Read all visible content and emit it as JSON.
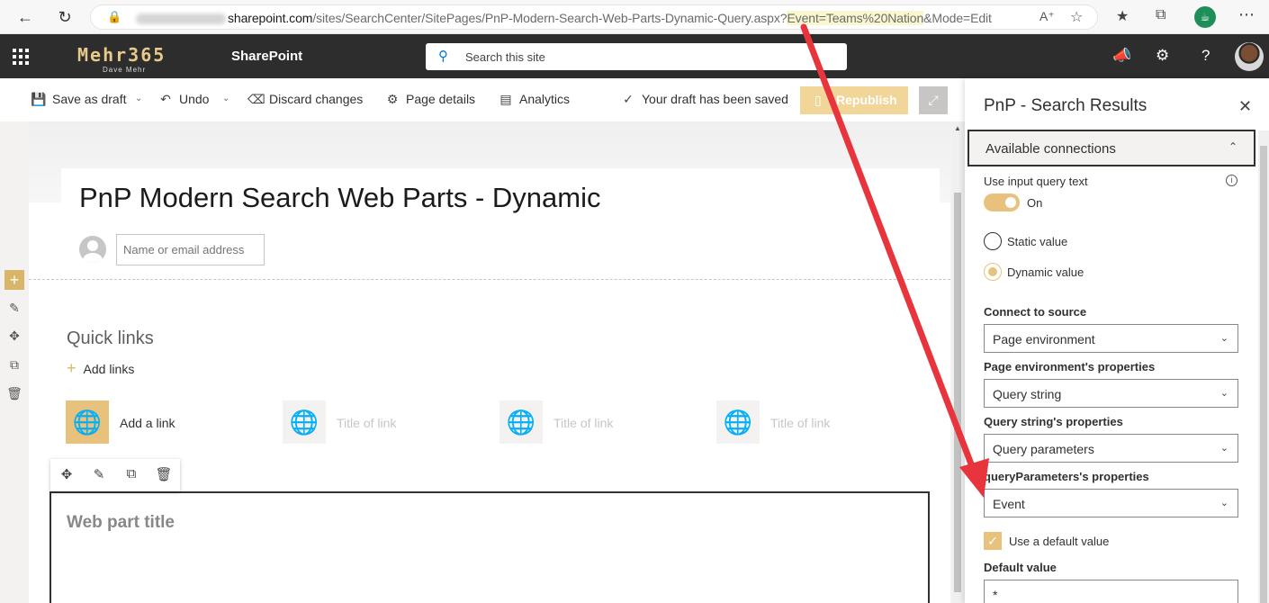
{
  "browser": {
    "url_domain": "sharepoint.com",
    "url_path": "/sites/SearchCenter/SitePages/PnP-Modern-Search-Web-Parts-Dynamic-Query.aspx?",
    "url_query_highlight": "Event=Teams%20Nation",
    "url_query_rest": "&Mode=Edit"
  },
  "suite": {
    "logo_text": "Mehr365",
    "logo_sub": "Dave Mehr",
    "app_name": "SharePoint",
    "search_placeholder": "Search this site"
  },
  "command_bar": {
    "save_draft": "Save as draft",
    "undo": "Undo",
    "discard": "Discard changes",
    "page_details": "Page details",
    "analytics": "Analytics",
    "status": "Your draft has been saved",
    "republish": "Republish"
  },
  "page": {
    "title": "PnP Modern Search Web Parts - Dynamic",
    "author_placeholder": "Name or email address",
    "quick_links": {
      "title": "Quick links",
      "add_links": "Add links",
      "tiles": [
        {
          "label": "Add a link"
        },
        {
          "label": "Title of link"
        },
        {
          "label": "Title of link"
        },
        {
          "label": "Title of link"
        }
      ]
    },
    "web_part_title": "Web part title"
  },
  "property_pane": {
    "title": "PnP - Search Results",
    "group": "Available connections",
    "use_input_query_text": "Use input query text",
    "toggle_state": "On",
    "static_value": "Static value",
    "dynamic_value": "Dynamic value",
    "connect_to_source_label": "Connect to source",
    "connect_to_source_value": "Page environment",
    "page_env_props_label": "Page environment's properties",
    "page_env_props_value": "Query string",
    "query_string_props_label": "Query string's properties",
    "query_string_props_value": "Query parameters",
    "query_params_props_label": "queryParameters's properties",
    "query_params_props_value": "Event",
    "use_default_value": "Use a default value",
    "default_value_label": "Default value",
    "default_value": "*"
  },
  "colors": {
    "accent": "#e8c27c",
    "suite_bar": "#2d2d2d",
    "annotation_arrow": "#e8343c"
  }
}
